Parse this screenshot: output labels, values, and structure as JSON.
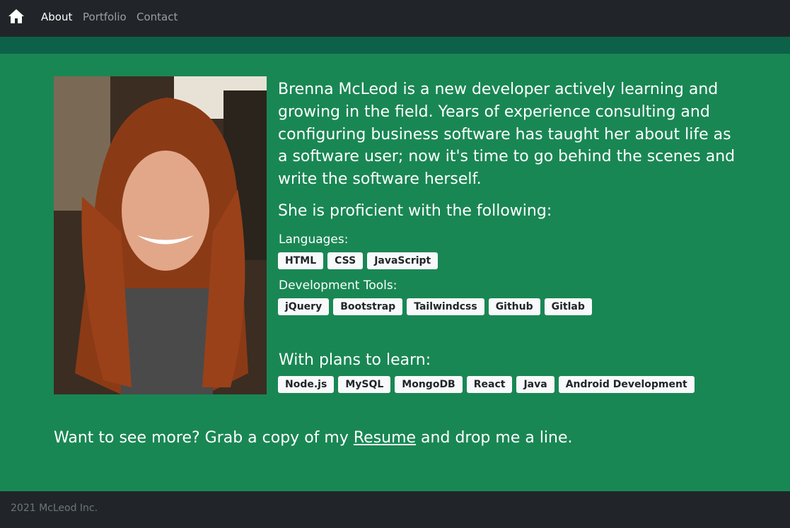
{
  "nav": {
    "home_icon": "home-icon",
    "links": [
      "About",
      "Portfolio",
      "Contact"
    ]
  },
  "bio": "Brenna McLeod is a new developer actively learning and growing in the field. Years of experience consulting and configuring business software has taught her about life as a software user; now it's time to go behind the scenes and write the software herself.",
  "skills": {
    "heading": "She is proficient with the following:",
    "languages_label": "Languages:",
    "languages": [
      "HTML",
      "CSS",
      "JavaScript"
    ],
    "tools_label": "Development Tools:",
    "tools": [
      "jQuery",
      "Bootstrap",
      "Tailwindcss",
      "Github",
      "Gitlab"
    ],
    "plans_label": "With plans to learn:",
    "plans": [
      "Node.js",
      "MySQL",
      "MongoDB",
      "React",
      "Java",
      "Android Development"
    ]
  },
  "cta": {
    "before": "Want to see more? Grab a copy of my ",
    "link": "Resume",
    "after": " and drop me a line."
  },
  "footer": "2021 McLeod Inc.",
  "colors": {
    "nav_bg": "#212529",
    "band": "#0c6148",
    "main_bg": "#198754",
    "badge_bg": "#f8f9fa"
  }
}
